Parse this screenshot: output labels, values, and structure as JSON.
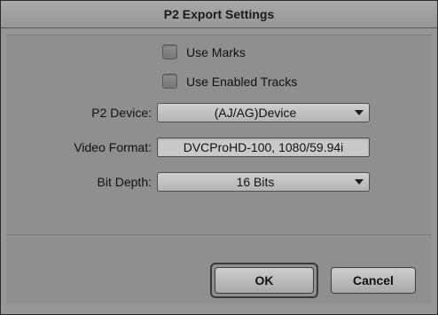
{
  "window": {
    "title": "P2 Export Settings"
  },
  "options": {
    "use_marks_label": "Use Marks",
    "use_marks_checked": false,
    "use_enabled_tracks_label": "Use Enabled Tracks",
    "use_enabled_tracks_checked": false
  },
  "fields": {
    "p2_device_label": "P2 Device:",
    "p2_device_value": "(AJ/AG)Device",
    "video_format_label": "Video Format:",
    "video_format_value": "DVCProHD-100, 1080/59.94i",
    "bit_depth_label": "Bit Depth:",
    "bit_depth_value": "16 Bits"
  },
  "buttons": {
    "ok_label": "OK",
    "cancel_label": "Cancel"
  },
  "icons": {
    "dropdown_arrow": "chevron-down-icon"
  }
}
